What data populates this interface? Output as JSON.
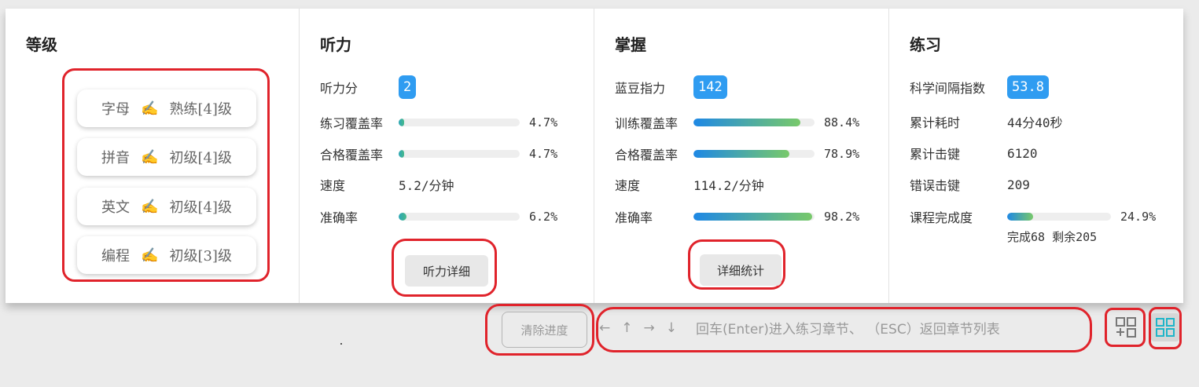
{
  "columns": {
    "level": {
      "title": "等级",
      "items": [
        {
          "name": "字母",
          "emoji": "✍",
          "level": "熟练[4]级"
        },
        {
          "name": "拼音",
          "emoji": "✍",
          "level": "初级[4]级"
        },
        {
          "name": "英文",
          "emoji": "✍",
          "level": "初级[4]级"
        },
        {
          "name": "编程",
          "emoji": "✍",
          "level": "初级[3]级"
        }
      ]
    },
    "listening": {
      "title": "听力",
      "score_label": "听力分",
      "score": "2",
      "practice_coverage_label": "练习覆盖率",
      "practice_coverage_pct": "4.7%",
      "practice_coverage": 4.7,
      "qualified_coverage_label": "合格覆盖率",
      "qualified_coverage_pct": "4.7%",
      "qualified_coverage": 4.7,
      "speed_label": "速度",
      "speed": "5.2/分钟",
      "accuracy_label": "准确率",
      "accuracy_pct": "6.2%",
      "accuracy": 6.2,
      "detail_button": "听力详细"
    },
    "mastery": {
      "title": "掌握",
      "bean_label": "蓝豆指力",
      "bean": "142",
      "training_coverage_label": "训练覆盖率",
      "training_coverage_pct": "88.4%",
      "training_coverage": 88.4,
      "qualified_coverage_label": "合格覆盖率",
      "qualified_coverage_pct": "78.9%",
      "qualified_coverage": 78.9,
      "speed_label": "速度",
      "speed": "114.2/分钟",
      "accuracy_label": "准确率",
      "accuracy_pct": "98.2%",
      "accuracy": 98.2,
      "detail_button": "详细统计"
    },
    "practice": {
      "title": "练习",
      "interval_label": "科学间隔指数",
      "interval": "53.8",
      "time_label": "累计耗时",
      "time": "44分40秒",
      "keys_label": "累计击键",
      "keys": "6120",
      "errors_label": "错误击键",
      "errors": "209",
      "completion_label": "课程完成度",
      "completion_pct": "24.9%",
      "completion": 24.9,
      "completion_detail": "完成68 剩余205"
    }
  },
  "toolbar": {
    "clear_button": "清除进度",
    "arrows": [
      "←",
      "↑",
      "→",
      "↓"
    ],
    "hint": "回车(Enter)进入练习章节、 （ESC）返回章节列表"
  },
  "colors": {
    "accent": "#2f9cf1",
    "highlight": "#e0232b",
    "bar_start": "#1e88e5",
    "bar_end": "#78c96a",
    "teal_icon": "#1fb5c9",
    "gray_icon": "#777777"
  }
}
